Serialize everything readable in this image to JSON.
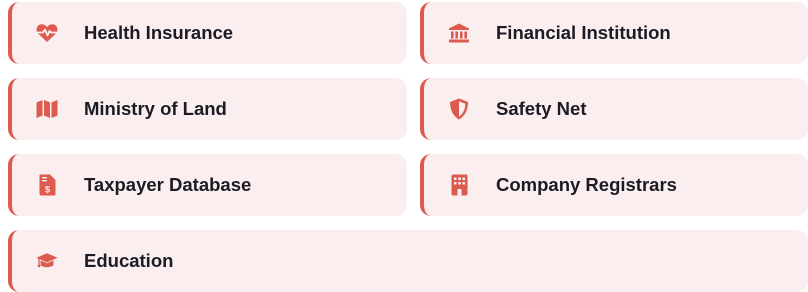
{
  "accent_color": "#dc5a4e",
  "card_background": "#fbeeee",
  "text_color": "#1b1b26",
  "items": [
    {
      "label": "Health Insurance",
      "icon": "heartbeat-icon"
    },
    {
      "label": "Financial Institution",
      "icon": "bank-icon"
    },
    {
      "label": "Ministry of Land",
      "icon": "map-icon"
    },
    {
      "label": "Safety Net",
      "icon": "shield-icon"
    },
    {
      "label": "Taxpayer Database",
      "icon": "invoice-dollar-icon"
    },
    {
      "label": "Company Registrars",
      "icon": "building-icon"
    },
    {
      "label": "Education",
      "icon": "graduation-cap-icon"
    }
  ]
}
